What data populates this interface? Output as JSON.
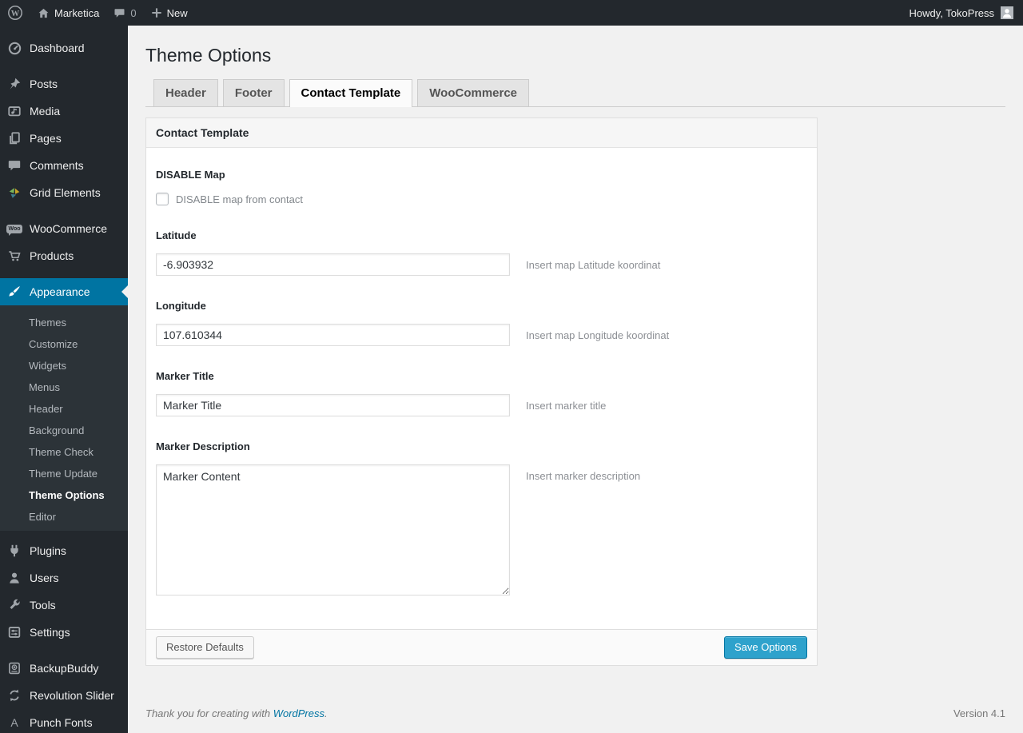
{
  "colors": {
    "admin_bar_bg": "#23282d",
    "sidebar_bg": "#23282d",
    "accent_active_menu": "#0074a2",
    "primary_button_bg": "#2ea2cc",
    "primary_button_border": "#0074a2",
    "page_bg": "#f1f1f1"
  },
  "admin_bar": {
    "wp_logo_icon": "wordpress-logo-icon",
    "home_icon": "home-icon",
    "site_name": "Marketica",
    "comments_icon": "comment-bubble-icon",
    "comment_count": "0",
    "new_icon": "plus-icon",
    "new_label": "New",
    "howdy": "Howdy, TokoPress",
    "avatar_icon": "user-avatar"
  },
  "sidebar": {
    "items": [
      {
        "label": "Dashboard",
        "icon": "dashboard-icon"
      },
      {
        "label": "Posts",
        "icon": "pushpin-icon"
      },
      {
        "label": "Media",
        "icon": "media-icon"
      },
      {
        "label": "Pages",
        "icon": "pages-icon"
      },
      {
        "label": "Comments",
        "icon": "comments-icon"
      },
      {
        "label": "Grid Elements",
        "icon": "grid-elements-icon"
      },
      {
        "label": "WooCommerce",
        "icon": "woocommerce-badge-icon"
      },
      {
        "label": "Products",
        "icon": "cart-icon"
      },
      {
        "label": "Appearance",
        "icon": "paintbrush-icon",
        "active": true
      },
      {
        "label": "Plugins",
        "icon": "plug-icon"
      },
      {
        "label": "Users",
        "icon": "person-icon"
      },
      {
        "label": "Tools",
        "icon": "wrench-icon"
      },
      {
        "label": "Settings",
        "icon": "settings-sliders-icon"
      },
      {
        "label": "BackupBuddy",
        "icon": "backup-disk-icon"
      },
      {
        "label": "Revolution Slider",
        "icon": "refresh-arrows-icon"
      },
      {
        "label": "Punch Fonts",
        "icon": "letter-a-icon",
        "icon_letter": "A"
      }
    ],
    "appearance_submenu": [
      {
        "label": "Themes"
      },
      {
        "label": "Customize"
      },
      {
        "label": "Widgets"
      },
      {
        "label": "Menus"
      },
      {
        "label": "Header"
      },
      {
        "label": "Background"
      },
      {
        "label": "Theme Check"
      },
      {
        "label": "Theme Update"
      },
      {
        "label": "Theme Options",
        "current": true
      },
      {
        "label": "Editor"
      }
    ]
  },
  "page": {
    "title": "Theme Options",
    "tabs": [
      {
        "label": "Header",
        "active": false
      },
      {
        "label": "Footer",
        "active": false
      },
      {
        "label": "Contact Template",
        "active": true
      },
      {
        "label": "WooCommerce",
        "active": false
      }
    ],
    "panel": {
      "title": "Contact Template",
      "fields": {
        "disable_map": {
          "label": "DISABLE Map",
          "checkbox_label": "DISABLE map from contact",
          "checked": false
        },
        "latitude": {
          "label": "Latitude",
          "value": "-6.903932",
          "help": "Insert map Latitude koordinat"
        },
        "longitude": {
          "label": "Longitude",
          "value": "107.610344",
          "help": "Insert map Longitude koordinat"
        },
        "marker_title": {
          "label": "Marker Title",
          "value": "Marker Title",
          "help": "Insert marker title"
        },
        "marker_description": {
          "label": "Marker Description",
          "value": "Marker Content",
          "help": "Insert marker description"
        }
      }
    },
    "actions": {
      "restore_label": "Restore Defaults",
      "save_label": "Save Options"
    },
    "footer": {
      "thanks_prefix": "Thank you for creating with ",
      "link_text": "WordPress",
      "thanks_suffix": ".",
      "version": "Version 4.1"
    }
  }
}
